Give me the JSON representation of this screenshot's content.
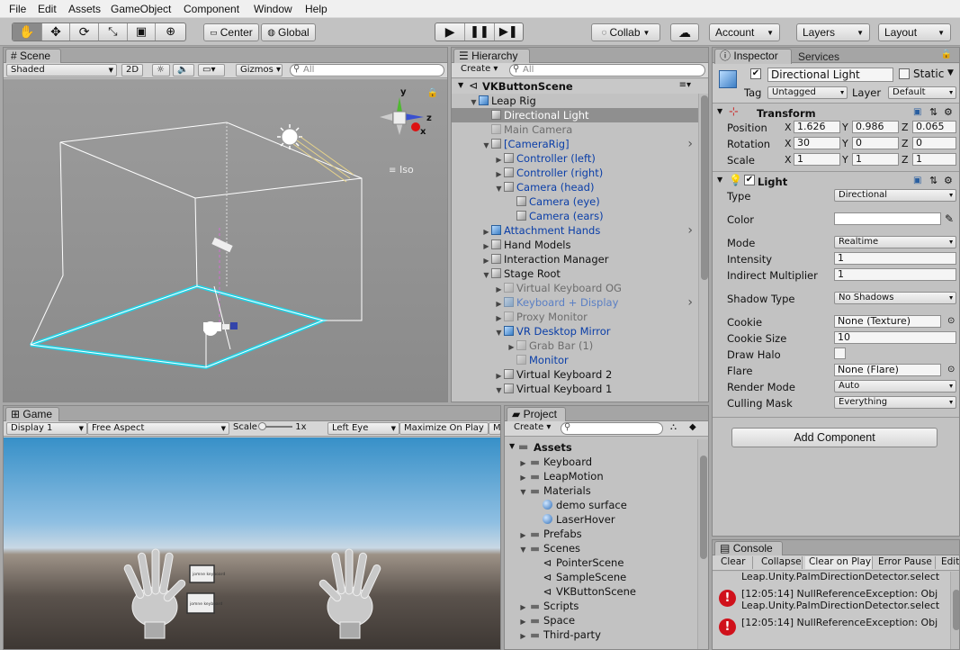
{
  "menu": [
    "File",
    "Edit",
    "Assets",
    "GameObject",
    "Component",
    "Window",
    "Help"
  ],
  "toolbar": {
    "pivot": "Center",
    "space": "Global",
    "collab": "Collab",
    "account": "Account",
    "layers": "Layers",
    "layout": "Layout"
  },
  "scene": {
    "tab": "Scene",
    "shading": "Shaded",
    "mode2d": "2D",
    "gizmos": "Gizmos",
    "search_placeholder": "All",
    "iso_label": "Iso",
    "axis_y": "y",
    "axis_z": "z",
    "axis_x": "x"
  },
  "hierarchy": {
    "tab": "Hierarchy",
    "create": "Create",
    "search_placeholder": "All",
    "scene_name": "VKButtonScene",
    "items": [
      {
        "label": "Leap Rig",
        "arrow": "▼",
        "indent": 0,
        "style": "normal",
        "cube": "blue"
      },
      {
        "label": "Directional Light",
        "arrow": "",
        "indent": 1,
        "style": "selected",
        "cube": "gray"
      },
      {
        "label": "Main Camera",
        "arrow": "",
        "indent": 1,
        "style": "faint",
        "cube": "gray faint"
      },
      {
        "label": "[CameraRig]",
        "arrow": "▼",
        "indent": 1,
        "style": "blue",
        "cube": "gray"
      },
      {
        "label": "Controller (left)",
        "arrow": "▶",
        "indent": 2,
        "style": "blue",
        "cube": "gray"
      },
      {
        "label": "Controller (right)",
        "arrow": "▶",
        "indent": 2,
        "style": "blue",
        "cube": "gray"
      },
      {
        "label": "Camera (head)",
        "arrow": "▼",
        "indent": 2,
        "style": "blue",
        "cube": "gray"
      },
      {
        "label": "Camera (eye)",
        "arrow": "",
        "indent": 3,
        "style": "blue",
        "cube": "gray"
      },
      {
        "label": "Camera (ears)",
        "arrow": "",
        "indent": 3,
        "style": "blue",
        "cube": "gray"
      },
      {
        "label": "Attachment Hands",
        "arrow": "▶",
        "indent": 1,
        "style": "blue",
        "cube": "blue"
      },
      {
        "label": "Hand Models",
        "arrow": "▶",
        "indent": 1,
        "style": "normal",
        "cube": "gray"
      },
      {
        "label": "Interaction Manager",
        "arrow": "▶",
        "indent": 1,
        "style": "normal",
        "cube": "gray"
      },
      {
        "label": "Stage Root",
        "arrow": "▼",
        "indent": 1,
        "style": "normal",
        "cube": "gray"
      },
      {
        "label": "Virtual Keyboard OG",
        "arrow": "▶",
        "indent": 2,
        "style": "faint",
        "cube": "gray faint"
      },
      {
        "label": "Keyboard + Display",
        "arrow": "▶",
        "indent": 2,
        "style": "faintblue",
        "cube": "blue faint"
      },
      {
        "label": "Proxy Monitor",
        "arrow": "▶",
        "indent": 2,
        "style": "faint",
        "cube": "gray faint"
      },
      {
        "label": "VR Desktop Mirror",
        "arrow": "▼",
        "indent": 2,
        "style": "blue",
        "cube": "blue"
      },
      {
        "label": "Grab Bar (1)",
        "arrow": "▶",
        "indent": 3,
        "style": "faint",
        "cube": "gray faint"
      },
      {
        "label": "Monitor",
        "arrow": "",
        "indent": 3,
        "style": "blue",
        "cube": "gray faint"
      },
      {
        "label": "Virtual Keyboard 2",
        "arrow": "▶",
        "indent": 2,
        "style": "normal",
        "cube": "gray"
      },
      {
        "label": "Virtual Keyboard 1",
        "arrow": "▼",
        "indent": 2,
        "style": "normal",
        "cube": "gray"
      }
    ]
  },
  "game": {
    "tab": "Game",
    "display": "Display 1",
    "aspect": "Free Aspect",
    "scale_label": "Scale",
    "scale_value": "1x",
    "eye": "Left Eye",
    "maximize": "Maximize On Play",
    "mute": "M",
    "card1": "jomne keyboard",
    "card2": "jomne keyboard"
  },
  "project": {
    "tab": "Project",
    "create": "Create",
    "root": "Assets",
    "items": [
      {
        "label": "Keyboard",
        "type": "folder",
        "indent": 1,
        "arrow": "▶"
      },
      {
        "label": "LeapMotion",
        "type": "folder",
        "indent": 1,
        "arrow": "▶"
      },
      {
        "label": "Materials",
        "type": "folder",
        "indent": 1,
        "arrow": "▼"
      },
      {
        "label": "demo surface",
        "type": "material",
        "indent": 2,
        "arrow": ""
      },
      {
        "label": "LaserHover",
        "type": "material",
        "indent": 2,
        "arrow": ""
      },
      {
        "label": "Prefabs",
        "type": "folder",
        "indent": 1,
        "arrow": "▶"
      },
      {
        "label": "Scenes",
        "type": "folder",
        "indent": 1,
        "arrow": "▼"
      },
      {
        "label": "PointerScene",
        "type": "unity",
        "indent": 2,
        "arrow": ""
      },
      {
        "label": "SampleScene",
        "type": "unity",
        "indent": 2,
        "arrow": ""
      },
      {
        "label": "VKButtonScene",
        "type": "unity",
        "indent": 2,
        "arrow": ""
      },
      {
        "label": "Scripts",
        "type": "folder",
        "indent": 1,
        "arrow": "▶"
      },
      {
        "label": "Space",
        "type": "folder",
        "indent": 1,
        "arrow": "▶"
      },
      {
        "label": "Third-party",
        "type": "folder",
        "indent": 1,
        "arrow": "▶"
      }
    ]
  },
  "inspector": {
    "tab": "Inspector",
    "tab2": "Services",
    "object_name": "Directional Light",
    "static_label": "Static",
    "tag_label": "Tag",
    "tag_value": "Untagged",
    "layer_label": "Layer",
    "layer_value": "Default",
    "transform": {
      "title": "Transform",
      "position_label": "Position",
      "rotation_label": "Rotation",
      "scale_label": "Scale",
      "position": [
        "1.626",
        "0.986",
        "0.065"
      ],
      "rotation": [
        "30",
        "0",
        "0"
      ],
      "scale": [
        "1",
        "1",
        "1"
      ]
    },
    "light": {
      "title": "Light",
      "rows": [
        {
          "label": "Type",
          "value": "Directional",
          "kind": "dd"
        },
        {
          "label": "Color",
          "value": "",
          "kind": "color"
        },
        {
          "label": "Mode",
          "value": "Realtime",
          "kind": "dd"
        },
        {
          "label": "Intensity",
          "value": "1",
          "kind": "field"
        },
        {
          "label": "Indirect Multiplier",
          "value": "1",
          "kind": "field"
        },
        {
          "label": "Shadow Type",
          "value": "No Shadows",
          "kind": "dd"
        },
        {
          "label": "Cookie",
          "value": "None (Texture)",
          "kind": "obj"
        },
        {
          "label": "Cookie Size",
          "value": "10",
          "kind": "field"
        },
        {
          "label": "Draw Halo",
          "value": "",
          "kind": "check"
        },
        {
          "label": "Flare",
          "value": "None (Flare)",
          "kind": "obj"
        },
        {
          "label": "Render Mode",
          "value": "Auto",
          "kind": "dd"
        },
        {
          "label": "Culling Mask",
          "value": "Everything",
          "kind": "dd"
        }
      ]
    },
    "add_component": "Add Component"
  },
  "console": {
    "tab": "Console",
    "buttons": [
      "Clear",
      "Collapse",
      "Clear on Play",
      "Error Pause",
      "Edit"
    ],
    "lines": [
      {
        "icon": false,
        "text": "Leap.Unity.PalmDirectionDetector.select"
      },
      {
        "icon": true,
        "text": "[12:05:14] NullReferenceException: Obj"
      },
      {
        "icon": false,
        "text": "Leap.Unity.PalmDirectionDetector.select"
      },
      {
        "icon": true,
        "text": "[12:05:14] NullReferenceException: Obj"
      }
    ]
  },
  "colors": {
    "accent": "#3a8ee6",
    "selection": "#8f8f8f",
    "cyan": "#22d3e6",
    "error": "#d0111b"
  }
}
